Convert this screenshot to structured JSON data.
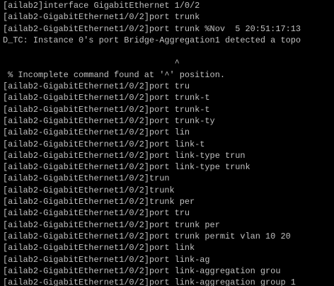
{
  "colors": {
    "background": "#000000",
    "foreground": "#c0c0c0"
  },
  "terminal": {
    "lines": [
      "[ailab2]interface GigabitEthernet 1/0/2",
      "[ailab2-GigabitEthernet1/0/2]port trunk",
      "[ailab2-GigabitEthernet1/0/2]port trunk %Nov  5 20:51:17:13",
      "D_TC: Instance 0's port Bridge-Aggregation1 detected a topo",
      "",
      "                                  ^",
      " % Incomplete command found at '^' position.",
      "[ailab2-GigabitEthernet1/0/2]port tru",
      "[ailab2-GigabitEthernet1/0/2]port trunk-t",
      "[ailab2-GigabitEthernet1/0/2]port trunk-t",
      "[ailab2-GigabitEthernet1/0/2]port trunk-ty",
      "[ailab2-GigabitEthernet1/0/2]port lin",
      "[ailab2-GigabitEthernet1/0/2]port link-t",
      "[ailab2-GigabitEthernet1/0/2]port link-type trun",
      "[ailab2-GigabitEthernet1/0/2]port link-type trunk",
      "[ailab2-GigabitEthernet1/0/2]trun",
      "[ailab2-GigabitEthernet1/0/2]trunk",
      "[ailab2-GigabitEthernet1/0/2]trunk per",
      "[ailab2-GigabitEthernet1/0/2]port tru",
      "[ailab2-GigabitEthernet1/0/2]port trunk per",
      "[ailab2-GigabitEthernet1/0/2]port trunk permit vlan 10 20",
      "[ailab2-GigabitEthernet1/0/2]port link",
      "[ailab2-GigabitEthernet1/0/2]port link-ag",
      "[ailab2-GigabitEthernet1/0/2]port link-aggregation grou",
      "[ailab2-GigabitEthernet1/0/2]port link-aggregation group 1"
    ]
  }
}
